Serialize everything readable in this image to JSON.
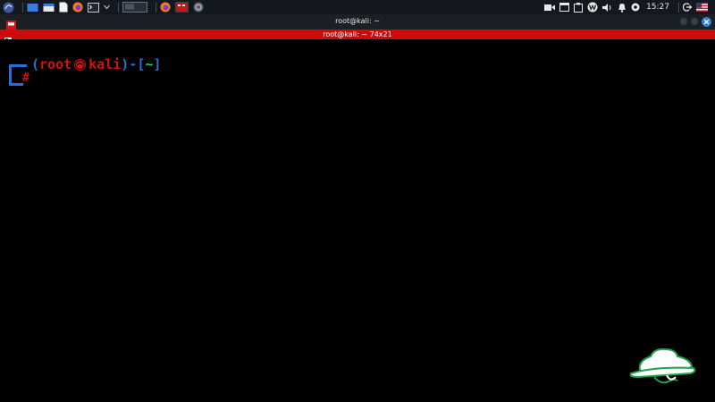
{
  "panel": {
    "clock": "15:27"
  },
  "window": {
    "title": "root@kali: ~"
  },
  "terminal": {
    "header": "root@kali: ~ 74x21",
    "prompt": {
      "open_paren": "(",
      "user": "root",
      "host": "kali",
      "close_paren": ")",
      "dash": "-",
      "open_bracket": "[",
      "dir": "~",
      "close_bracket": "]",
      "symbol": "#"
    }
  },
  "colors": {
    "accent_red": "#cf0a0a",
    "prompt_blue": "#2a6fd6",
    "prompt_red": "#d01313",
    "prompt_green": "#26c26e",
    "panel_bg": "#15191f"
  }
}
